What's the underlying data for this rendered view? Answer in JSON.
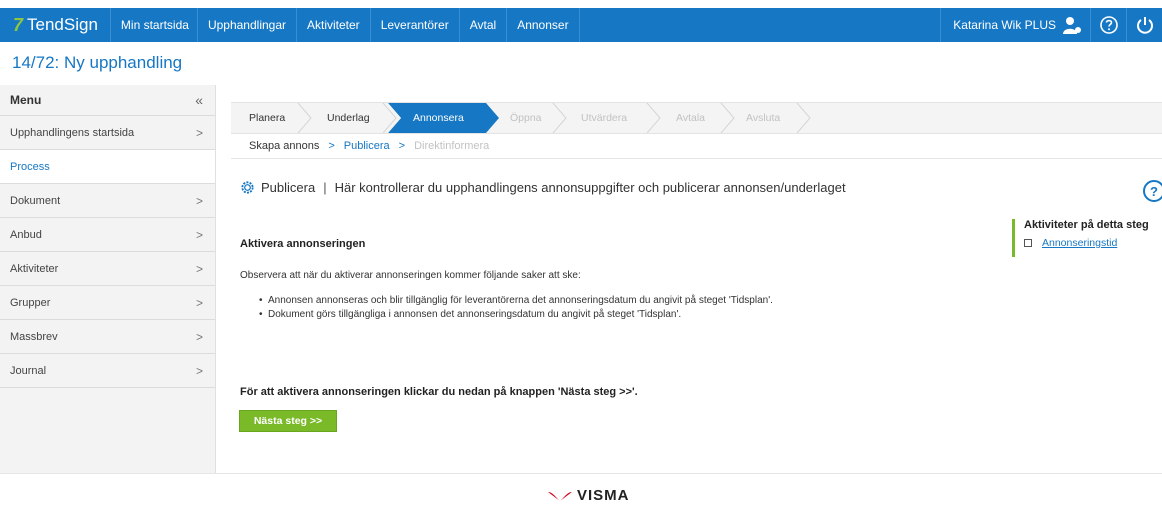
{
  "topnav": {
    "brand": "TendSign",
    "items": [
      "Min startsida",
      "Upphandlingar",
      "Aktiviteter",
      "Leverantörer",
      "Avtal",
      "Annonser"
    ],
    "user": "Katarina Wik PLUS",
    "help_icon": "help-circle-icon",
    "power_icon": "power-icon"
  },
  "page": {
    "title": "14/72: Ny upphandling"
  },
  "sidebar": {
    "header": "Menu",
    "collapse_glyph": "«",
    "items": [
      {
        "label": "Upphandlingens startsida",
        "has_chevron": true
      },
      {
        "label": "Process",
        "has_chevron": false,
        "active": true
      },
      {
        "label": "Dokument",
        "has_chevron": true
      },
      {
        "label": "Anbud",
        "has_chevron": true
      },
      {
        "label": "Aktiviteter",
        "has_chevron": true
      },
      {
        "label": "Grupper",
        "has_chevron": true
      },
      {
        "label": "Massbrev",
        "has_chevron": true
      },
      {
        "label": "Journal",
        "has_chevron": true
      }
    ]
  },
  "process_steps": {
    "steps": [
      "Planera",
      "Underlag",
      "Annonsera",
      "Öppna",
      "Utvärdera",
      "Avtala",
      "Avsluta"
    ],
    "current": "Annonsera",
    "substeps": [
      "Skapa annons",
      "Publicera",
      "Direktinformera"
    ],
    "current_substep": "Publicera"
  },
  "content": {
    "heading_title": "Publicera",
    "heading_separator": "|",
    "heading_text": "Här kontrollerar du upphandlingens annonsuppgifter och publicerar annonsen/underlaget",
    "section_title": "Aktivera annonseringen",
    "intro": "Observera att när du aktiverar annonseringen kommer följande saker att ske:",
    "bullets": [
      "Annonsen annonseras och blir tillgänglig för leverantörerna det annonseringsdatum du angivit på steget 'Tidsplan'.",
      "Dokument görs tillgängliga i annonsen det annonseringsdatum du angivit på steget 'Tidsplan'."
    ],
    "cta_text": "För att aktivera annonseringen klickar du nedan på knappen 'Nästa steg >>'.",
    "next_button": "Nästa steg >>",
    "help_glyph": "?"
  },
  "activities": {
    "title": "Aktiviteter på detta steg",
    "items": [
      {
        "label": "Annonseringstid",
        "checked": false
      }
    ]
  },
  "footer": {
    "brand": "VISMA"
  },
  "colors": {
    "primary": "#1677c4",
    "accent_green": "#7ab928",
    "nav_bg": "#1677c4",
    "sidebar_bg": "#f3f3f3"
  }
}
